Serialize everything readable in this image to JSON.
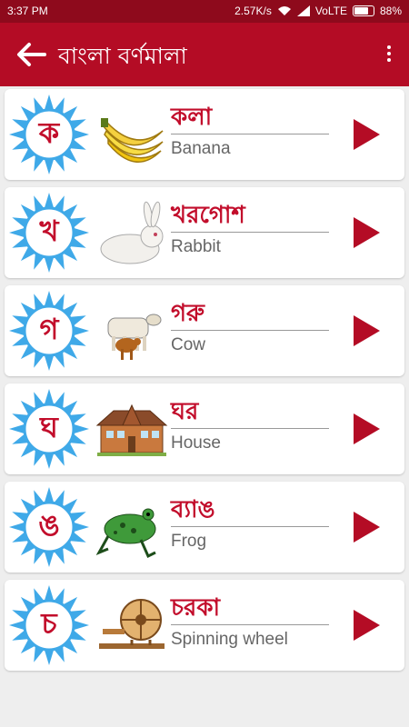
{
  "status_bar": {
    "time": "3:37 PM",
    "network_speed": "2.57K/s",
    "network_type": "VoLTE",
    "battery_percent": "88%",
    "battery_level": 0.88
  },
  "app_bar": {
    "title": "বাংলা বর্ণমালা",
    "back_icon": "arrow-left-icon",
    "menu_icon": "more-vert-icon"
  },
  "colors": {
    "primary": "#b40c25",
    "status_bar": "#8e0a1c",
    "accent_text": "#c20d2b",
    "badge_blue": "#3fa9e8"
  },
  "items": [
    {
      "letter": "ক",
      "word_bn": "কলা",
      "word_en": "Banana",
      "image": "banana-image"
    },
    {
      "letter": "খ",
      "word_bn": "খরগোশ",
      "word_en": "Rabbit",
      "image": "rabbit-image"
    },
    {
      "letter": "গ",
      "word_bn": "গরু",
      "word_en": "Cow",
      "image": "cow-image"
    },
    {
      "letter": "ঘ",
      "word_bn": "ঘর",
      "word_en": "House",
      "image": "house-image"
    },
    {
      "letter": "ঙ",
      "word_bn": "ব্যাঙ",
      "word_en": "Frog",
      "image": "frog-image"
    },
    {
      "letter": "চ",
      "word_bn": "চরকা",
      "word_en": "Spinning wheel",
      "image": "spinning-wheel-image"
    }
  ]
}
